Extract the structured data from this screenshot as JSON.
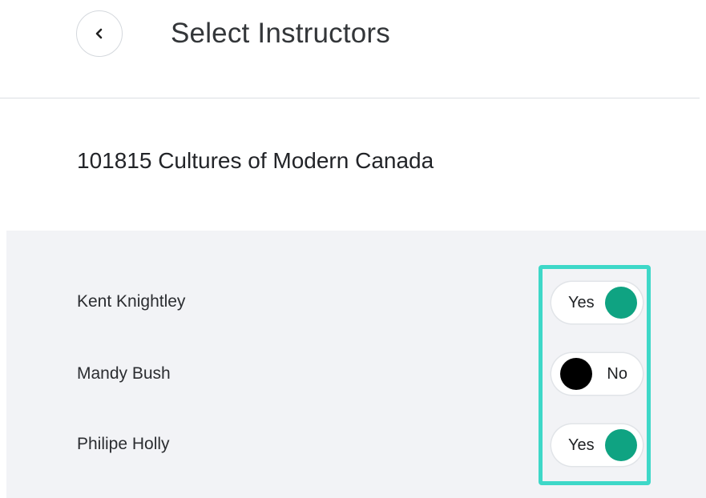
{
  "header": {
    "back_icon": "chevron-left-icon",
    "title": "Select Instructors"
  },
  "course": {
    "title": "101815 Cultures of Modern Canada"
  },
  "colors": {
    "toggle_on_knob": "#0fa382",
    "toggle_off_knob": "#000000",
    "highlight": "#3ed8c8"
  },
  "instructors": [
    {
      "name": "Kent Knightley",
      "selected": true,
      "toggle_label": "Yes"
    },
    {
      "name": "Mandy Bush",
      "selected": false,
      "toggle_label": "No"
    },
    {
      "name": "Philipe Holly",
      "selected": true,
      "toggle_label": "Yes"
    }
  ]
}
